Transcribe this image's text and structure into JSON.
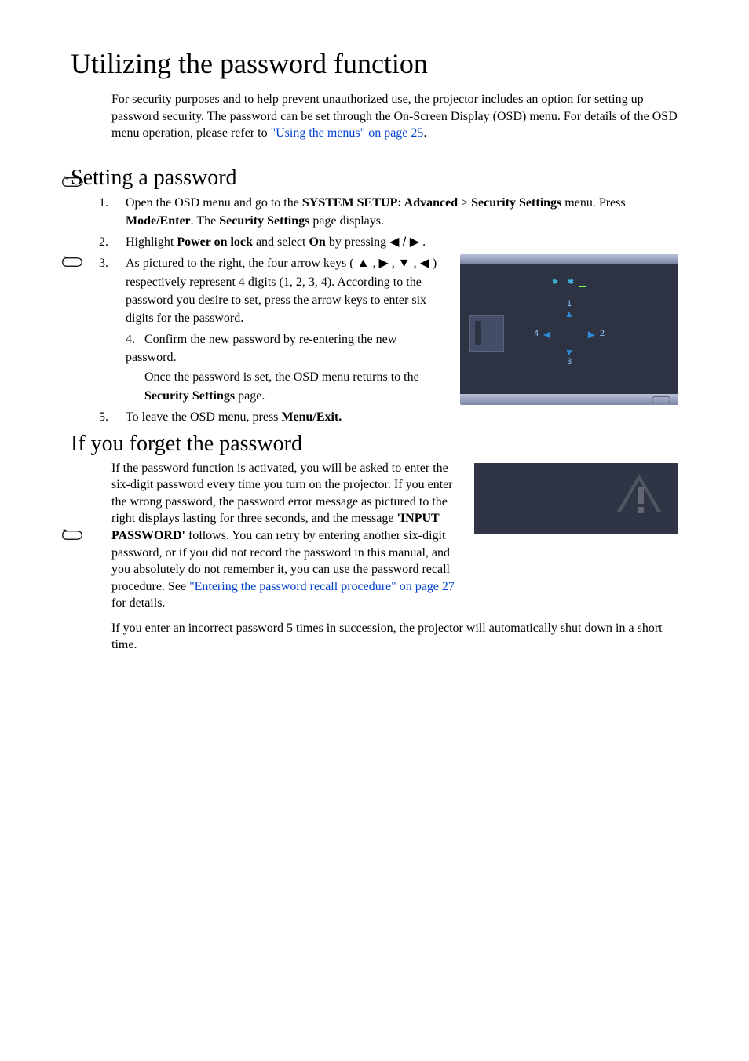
{
  "h1": "Utilizing the password function",
  "intro_part1": "For security purposes and to help prevent unauthorized use, the projector includes an option for setting up password security. The password can be set through the On-Screen Display (OSD) menu. For details of the OSD menu operation, please refer to ",
  "intro_link1": "\"Using the menus\" on page 25",
  "intro_part2": ".",
  "h2_setting": "Setting a password",
  "step1_a": "Open the OSD menu and go to the ",
  "step1_b": "SYSTEM SETUP: Advanced",
  "step1_c": " > ",
  "step1_d": "Security Settings",
  "step1_e": " menu. Press ",
  "step1_f": "Mode/Enter",
  "step1_g": ". The ",
  "step1_h": "Security Settings",
  "step1_i": " page displays.",
  "step2_a": "Highlight ",
  "step2_b": "Power on lock",
  "step2_c": " and select ",
  "step2_d": "On",
  "step2_e": " by pressing ",
  "step2_arrows": "◀ / ▶",
  "step2_f": " .",
  "step3_a": "As pictured to the right, the four arrow keys ( ",
  "step3_up": "▲",
  "step3_b": " , ",
  "step3_right": "▶",
  "step3_c": " , ",
  "step3_down": "▼",
  "step3_d": " , ",
  "step3_left": "◀",
  "step3_e": " ) respectively represent 4 digits (1, 2, 3, 4). According to the password you desire to set, press the arrow keys to enter six digits for the password.",
  "step4_a": "Confirm the new password by re-entering the new password.",
  "step4_b": "Once the password is set, the OSD menu returns to the ",
  "step4_c": "Security Settings",
  "step4_d": " page.",
  "step5_a": "To leave the OSD menu, press ",
  "step5_b": "Menu/Exit.",
  "h2_forget": "If you forget the password",
  "forget_a": "If the password function is activated, you will be asked to enter the six-digit password every time you turn on the projector. If you enter the wrong password, the password error message as pictured to the right displays lasting for three seconds, and the message ",
  "forget_b": "'INPUT PASSWORD'",
  "forget_c": " follows. You can retry by entering another six-digit password, or if you did not record the password in this manual, and you absolutely do not remember it, you can use the password recall procedure. See ",
  "forget_link": "\"Entering the password recall procedure\" on page 27",
  "forget_d": " for details.",
  "forget_e": "If you enter an incorrect password 5 times in succession, the projector will automatically shut down in a short time.",
  "osd": {
    "stars": "* *",
    "digits": {
      "up": "1",
      "right": "2",
      "down": "3",
      "left": "4"
    },
    "arrows": {
      "up": "▲",
      "right": "▶",
      "down": "▼",
      "left": "◀"
    }
  }
}
